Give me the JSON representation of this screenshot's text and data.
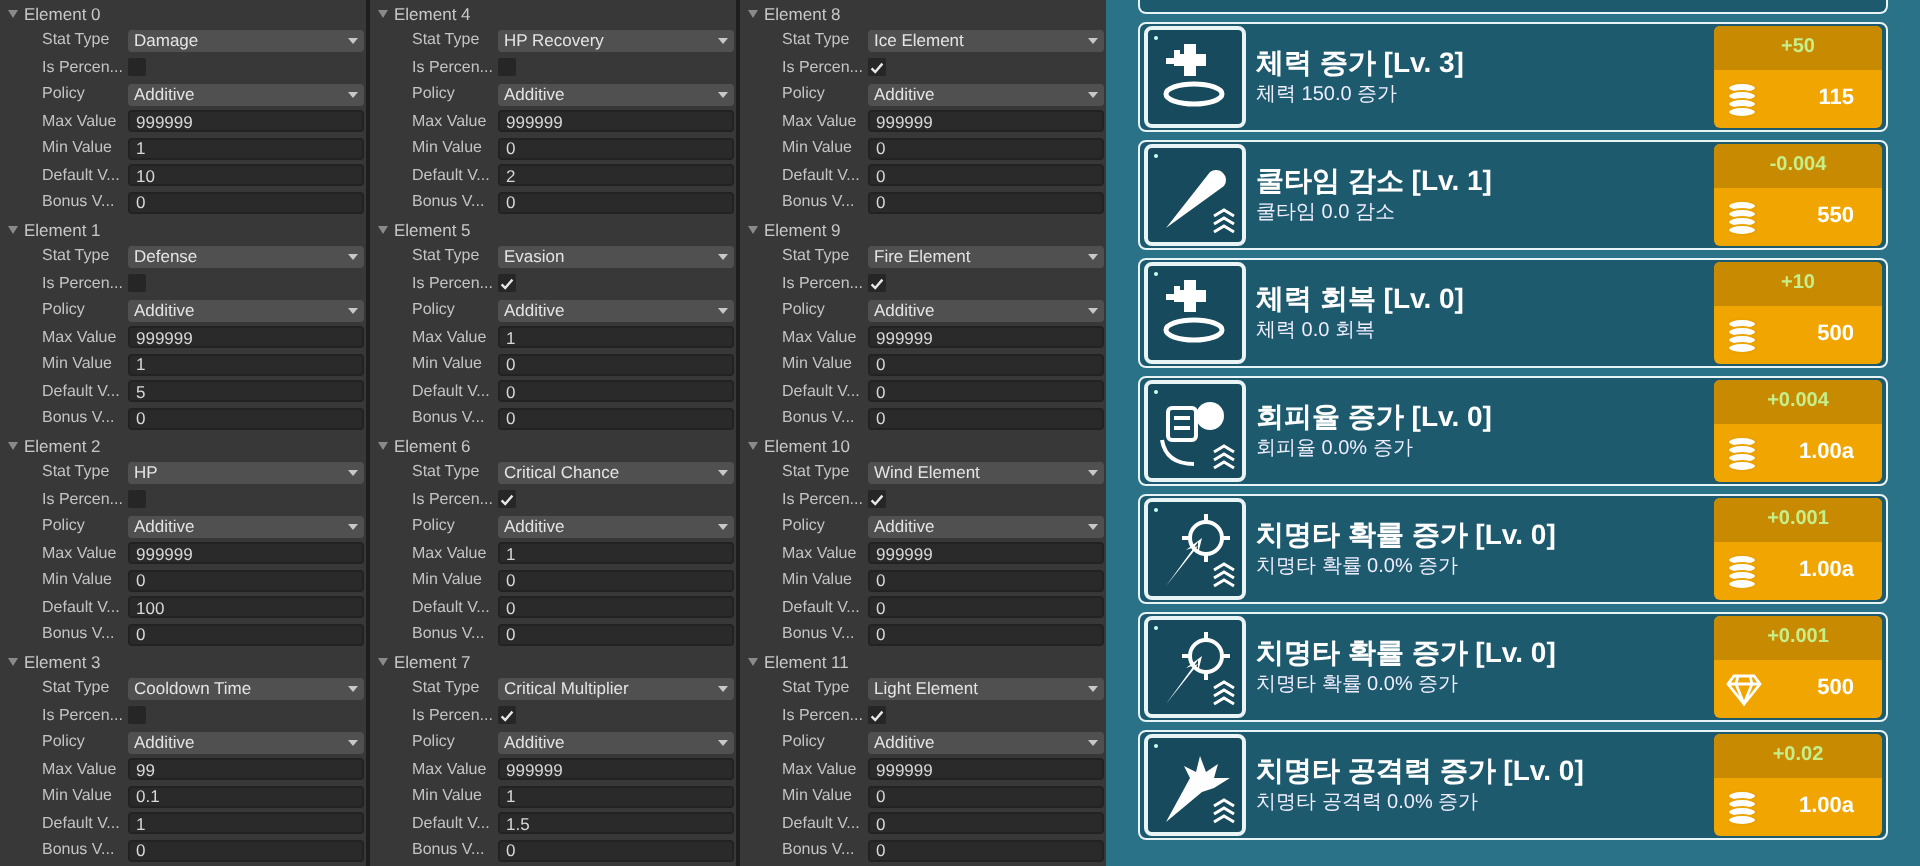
{
  "inspector": {
    "columns": [
      {
        "elements": [
          {
            "header": "Element 0",
            "expanded": true,
            "fields": [
              {
                "kind": "dropdown",
                "label": "Stat Type",
                "value": "Damage"
              },
              {
                "kind": "checkbox",
                "label": "Is Percen...",
                "checked": false
              },
              {
                "kind": "dropdown",
                "label": "Policy",
                "value": "Additive"
              },
              {
                "kind": "number",
                "label": "Max Value",
                "value": "999999"
              },
              {
                "kind": "number",
                "label": "Min Value",
                "value": "1"
              },
              {
                "kind": "number",
                "label": "Default V...",
                "value": "10"
              },
              {
                "kind": "number",
                "label": "Bonus V...",
                "value": "0"
              }
            ]
          },
          {
            "header": "Element 1",
            "expanded": true,
            "fields": [
              {
                "kind": "dropdown",
                "label": "Stat Type",
                "value": "Defense"
              },
              {
                "kind": "checkbox",
                "label": "Is Percen...",
                "checked": false
              },
              {
                "kind": "dropdown",
                "label": "Policy",
                "value": "Additive"
              },
              {
                "kind": "number",
                "label": "Max Value",
                "value": "999999"
              },
              {
                "kind": "number",
                "label": "Min Value",
                "value": "1"
              },
              {
                "kind": "number",
                "label": "Default V...",
                "value": "5"
              },
              {
                "kind": "number",
                "label": "Bonus V...",
                "value": "0"
              }
            ]
          },
          {
            "header": "Element 2",
            "expanded": true,
            "fields": [
              {
                "kind": "dropdown",
                "label": "Stat Type",
                "value": "HP"
              },
              {
                "kind": "checkbox",
                "label": "Is Percen...",
                "checked": false
              },
              {
                "kind": "dropdown",
                "label": "Policy",
                "value": "Additive"
              },
              {
                "kind": "number",
                "label": "Max Value",
                "value": "999999"
              },
              {
                "kind": "number",
                "label": "Min Value",
                "value": "0"
              },
              {
                "kind": "number",
                "label": "Default V...",
                "value": "100"
              },
              {
                "kind": "number",
                "label": "Bonus V...",
                "value": "0"
              }
            ]
          },
          {
            "header": "Element 3",
            "expanded": true,
            "fields": [
              {
                "kind": "dropdown",
                "label": "Stat Type",
                "value": "Cooldown Time"
              },
              {
                "kind": "checkbox",
                "label": "Is Percen...",
                "checked": false
              },
              {
                "kind": "dropdown",
                "label": "Policy",
                "value": "Additive"
              },
              {
                "kind": "number",
                "label": "Max Value",
                "value": "99"
              },
              {
                "kind": "number",
                "label": "Min Value",
                "value": "0.1"
              },
              {
                "kind": "number",
                "label": "Default V...",
                "value": "1"
              },
              {
                "kind": "number",
                "label": "Bonus V...",
                "value": "0"
              }
            ]
          }
        ]
      },
      {
        "elements": [
          {
            "header": "Element 4",
            "expanded": true,
            "fields": [
              {
                "kind": "dropdown",
                "label": "Stat Type",
                "value": "HP Recovery"
              },
              {
                "kind": "checkbox",
                "label": "Is Percen...",
                "checked": false
              },
              {
                "kind": "dropdown",
                "label": "Policy",
                "value": "Additive"
              },
              {
                "kind": "number",
                "label": "Max Value",
                "value": "999999"
              },
              {
                "kind": "number",
                "label": "Min Value",
                "value": "0"
              },
              {
                "kind": "number",
                "label": "Default V...",
                "value": "2"
              },
              {
                "kind": "number",
                "label": "Bonus V...",
                "value": "0"
              }
            ]
          },
          {
            "header": "Element 5",
            "expanded": true,
            "fields": [
              {
                "kind": "dropdown",
                "label": "Stat Type",
                "value": "Evasion"
              },
              {
                "kind": "checkbox",
                "label": "Is Percen...",
                "checked": true
              },
              {
                "kind": "dropdown",
                "label": "Policy",
                "value": "Additive"
              },
              {
                "kind": "number",
                "label": "Max Value",
                "value": "1"
              },
              {
                "kind": "number",
                "label": "Min Value",
                "value": "0"
              },
              {
                "kind": "number",
                "label": "Default V...",
                "value": "0"
              },
              {
                "kind": "number",
                "label": "Bonus V...",
                "value": "0"
              }
            ]
          },
          {
            "header": "Element 6",
            "expanded": true,
            "fields": [
              {
                "kind": "dropdown",
                "label": "Stat Type",
                "value": "Critical Chance"
              },
              {
                "kind": "checkbox",
                "label": "Is Percen...",
                "checked": true
              },
              {
                "kind": "dropdown",
                "label": "Policy",
                "value": "Additive"
              },
              {
                "kind": "number",
                "label": "Max Value",
                "value": "1"
              },
              {
                "kind": "number",
                "label": "Min Value",
                "value": "0"
              },
              {
                "kind": "number",
                "label": "Default V...",
                "value": "0"
              },
              {
                "kind": "number",
                "label": "Bonus V...",
                "value": "0"
              }
            ]
          },
          {
            "header": "Element 7",
            "expanded": true,
            "fields": [
              {
                "kind": "dropdown",
                "label": "Stat Type",
                "value": "Critical Multiplier"
              },
              {
                "kind": "checkbox",
                "label": "Is Percen...",
                "checked": true
              },
              {
                "kind": "dropdown",
                "label": "Policy",
                "value": "Additive"
              },
              {
                "kind": "number",
                "label": "Max Value",
                "value": "999999"
              },
              {
                "kind": "number",
                "label": "Min Value",
                "value": "1"
              },
              {
                "kind": "number",
                "label": "Default V...",
                "value": "1.5"
              },
              {
                "kind": "number",
                "label": "Bonus V...",
                "value": "0"
              }
            ]
          }
        ]
      },
      {
        "elements": [
          {
            "header": "Element 8",
            "expanded": true,
            "fields": [
              {
                "kind": "dropdown",
                "label": "Stat Type",
                "value": "Ice Element"
              },
              {
                "kind": "checkbox",
                "label": "Is Percen...",
                "checked": true
              },
              {
                "kind": "dropdown",
                "label": "Policy",
                "value": "Additive"
              },
              {
                "kind": "number",
                "label": "Max Value",
                "value": "999999"
              },
              {
                "kind": "number",
                "label": "Min Value",
                "value": "0"
              },
              {
                "kind": "number",
                "label": "Default V...",
                "value": "0"
              },
              {
                "kind": "number",
                "label": "Bonus V...",
                "value": "0"
              }
            ]
          },
          {
            "header": "Element 9",
            "expanded": true,
            "fields": [
              {
                "kind": "dropdown",
                "label": "Stat Type",
                "value": "Fire Element"
              },
              {
                "kind": "checkbox",
                "label": "Is Percen...",
                "checked": true
              },
              {
                "kind": "dropdown",
                "label": "Policy",
                "value": "Additive"
              },
              {
                "kind": "number",
                "label": "Max Value",
                "value": "999999"
              },
              {
                "kind": "number",
                "label": "Min Value",
                "value": "0"
              },
              {
                "kind": "number",
                "label": "Default V...",
                "value": "0"
              },
              {
                "kind": "number",
                "label": "Bonus V...",
                "value": "0"
              }
            ]
          },
          {
            "header": "Element 10",
            "expanded": true,
            "fields": [
              {
                "kind": "dropdown",
                "label": "Stat Type",
                "value": "Wind Element"
              },
              {
                "kind": "checkbox",
                "label": "Is Percen...",
                "checked": true
              },
              {
                "kind": "dropdown",
                "label": "Policy",
                "value": "Additive"
              },
              {
                "kind": "number",
                "label": "Max Value",
                "value": "999999"
              },
              {
                "kind": "number",
                "label": "Min Value",
                "value": "0"
              },
              {
                "kind": "number",
                "label": "Default V...",
                "value": "0"
              },
              {
                "kind": "number",
                "label": "Bonus V...",
                "value": "0"
              }
            ]
          },
          {
            "header": "Element 11",
            "expanded": true,
            "fields": [
              {
                "kind": "dropdown",
                "label": "Stat Type",
                "value": "Light Element"
              },
              {
                "kind": "checkbox",
                "label": "Is Percen...",
                "checked": true
              },
              {
                "kind": "dropdown",
                "label": "Policy",
                "value": "Additive"
              },
              {
                "kind": "number",
                "label": "Max Value",
                "value": "999999"
              },
              {
                "kind": "number",
                "label": "Min Value",
                "value": "0"
              },
              {
                "kind": "number",
                "label": "Default V...",
                "value": "0"
              },
              {
                "kind": "number",
                "label": "Bonus V...",
                "value": "0"
              }
            ]
          }
        ]
      }
    ]
  },
  "upgrades": [
    {
      "kind": "hp",
      "title": "체력 증가 [Lv. 3]",
      "description": "체력 150.0 증가",
      "increment": "+50",
      "cost": {
        "kind": "coin",
        "value": "115"
      }
    },
    {
      "kind": "cooldown",
      "title": "쿨타임 감소 [Lv. 1]",
      "description": "쿨타임 0.0 감소",
      "increment": "-0.004",
      "cost": {
        "kind": "coin",
        "value": "550"
      }
    },
    {
      "kind": "hp",
      "title": "체력 회복 [Lv. 0]",
      "description": "체력 0.0 회복",
      "increment": "+10",
      "cost": {
        "kind": "coin",
        "value": "500"
      }
    },
    {
      "kind": "evasion",
      "title": "회피율 증가 [Lv. 0]",
      "description": "회피율 0.0% 증가",
      "increment": "+0.004",
      "cost": {
        "kind": "coin",
        "value": "1.00a"
      }
    },
    {
      "kind": "crit",
      "title": "치명타 확률 증가 [Lv. 0]",
      "description": "치명타 확률 0.0% 증가",
      "increment": "+0.001",
      "cost": {
        "kind": "coin",
        "value": "1.00a"
      }
    },
    {
      "kind": "crit",
      "title": "치명타 확률 증가 [Lv. 0]",
      "description": "치명타 확률 0.0% 증가",
      "increment": "+0.001",
      "cost": {
        "kind": "gem",
        "value": "500"
      }
    },
    {
      "kind": "crit_damage",
      "title": "치명타 공격력 증가 [Lv. 0]",
      "description": "치명타 공격력 0.0% 증가",
      "increment": "+0.02",
      "cost": {
        "kind": "coin",
        "value": "1.00a"
      }
    }
  ]
}
